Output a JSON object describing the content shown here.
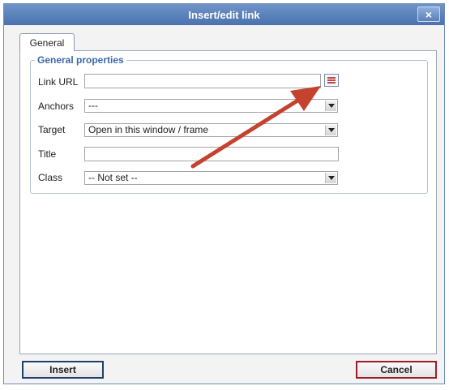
{
  "window": {
    "title": "Insert/edit link",
    "close_label": "×"
  },
  "tabs": [
    {
      "label": "General"
    }
  ],
  "general_properties": {
    "legend": "General properties",
    "fields": {
      "link_url": {
        "label": "Link URL",
        "value": ""
      },
      "anchors": {
        "label": "Anchors",
        "value": "---"
      },
      "target": {
        "label": "Target",
        "value": "Open in this window / frame"
      },
      "title": {
        "label": "Title",
        "value": ""
      },
      "class": {
        "label": "Class",
        "value": "-- Not set --"
      }
    }
  },
  "buttons": {
    "insert": "Insert",
    "cancel": "Cancel"
  },
  "colors": {
    "titlebar": "#4a72ad",
    "annotation_arrow": "#c4432e",
    "insert_border": "#1f3f6f",
    "cancel_border": "#9c1d26"
  },
  "icons": {
    "browse": "browse-list-icon",
    "close": "close-icon"
  }
}
